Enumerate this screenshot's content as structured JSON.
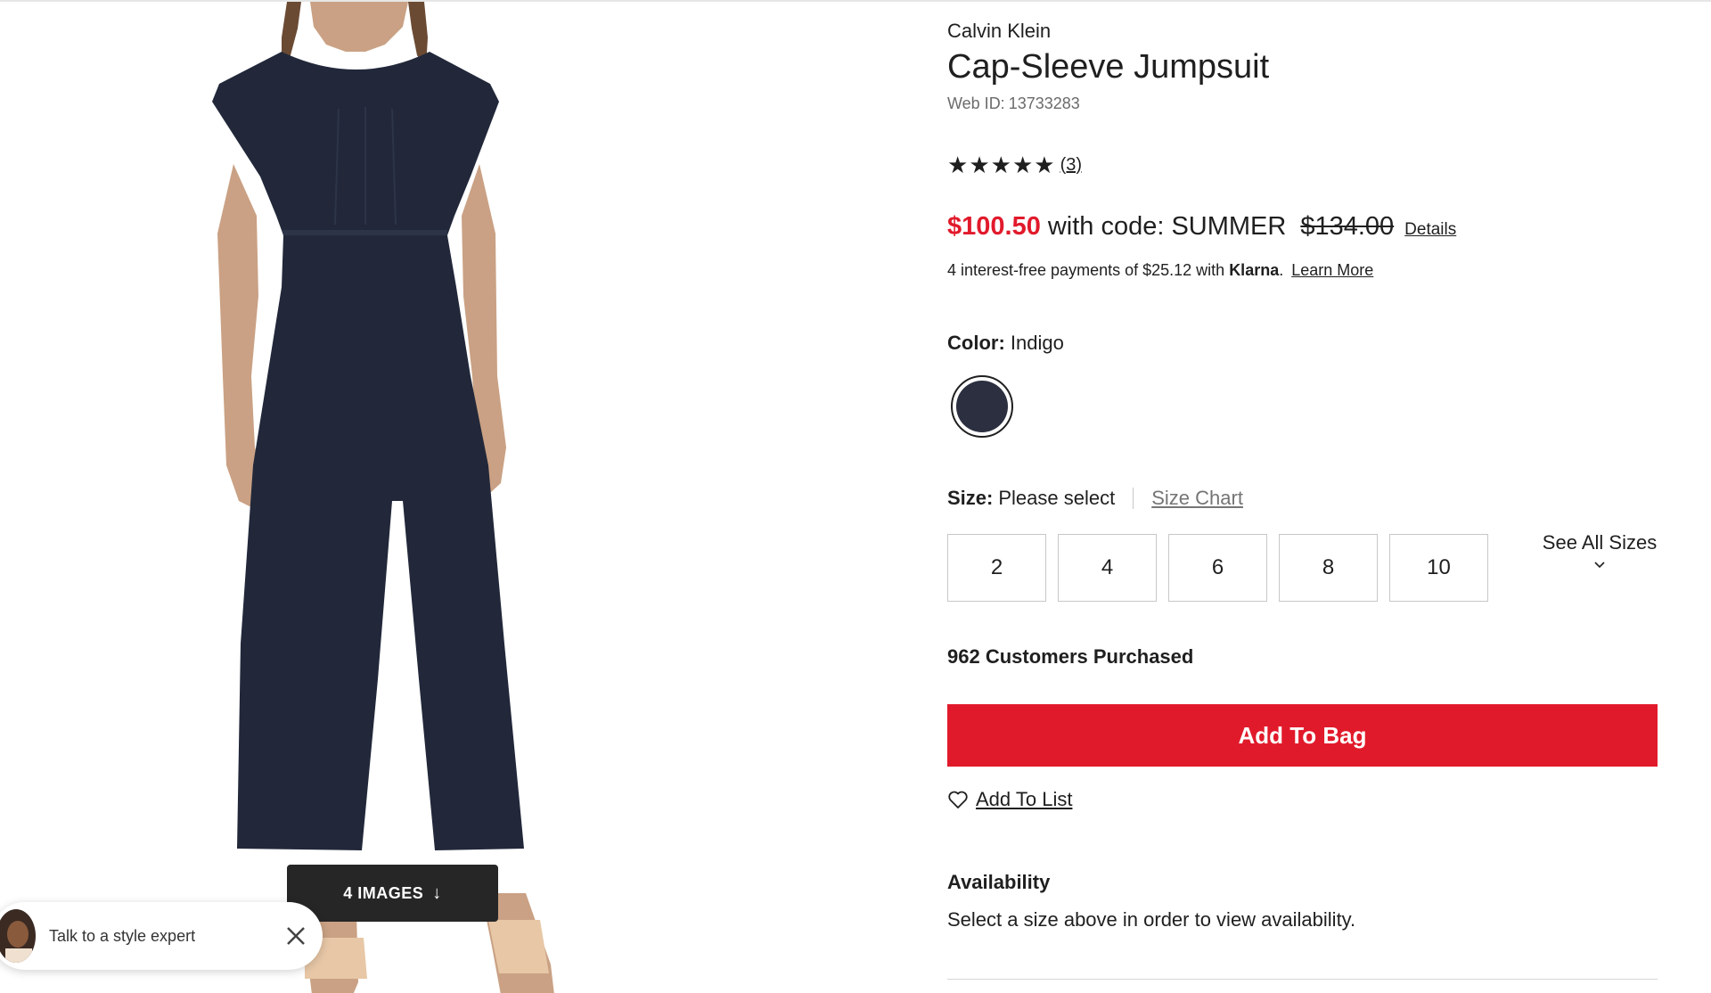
{
  "product": {
    "brand": "Calvin Klein",
    "title": "Cap-Sleeve Jumpsuit",
    "web_id_label": "Web ID:",
    "web_id": "13733283",
    "image_alt": "model wearing indigo cap-sleeve jumpsuit",
    "image_counter_label": "4 IMAGES",
    "image_counter_arrow": "↓"
  },
  "rating": {
    "stars": 5,
    "review_count": "(3)"
  },
  "pricing": {
    "sale_price": "$100.50",
    "promo_text": "with code: SUMMER",
    "original_price": "$134.00",
    "details_label": "Details",
    "sale_color": "#e11a2b"
  },
  "klarna": {
    "text": "4 interest-free payments of $25.12 with",
    "logo": "Klarna",
    "learn_more": "Learn More"
  },
  "color": {
    "label": "Color:",
    "selected": "Indigo",
    "swatch_hex": "#2b2f3f"
  },
  "size": {
    "label": "Size:",
    "value": "Please select",
    "chart_link": "Size Chart",
    "options": [
      "2",
      "4",
      "6",
      "8",
      "10"
    ],
    "see_all_label": "See All Sizes"
  },
  "social_proof": {
    "purchased": "962 Customers Purchased"
  },
  "actions": {
    "add_to_bag": "Add To Bag",
    "add_to_list": "Add To List",
    "accent_color": "#e11a2b"
  },
  "availability": {
    "title": "Availability",
    "text": "Select a size above in order to view availability."
  },
  "chat": {
    "label": "Talk to a style expert",
    "avatar_icon": "person-avatar",
    "close_icon": "close-icon"
  }
}
